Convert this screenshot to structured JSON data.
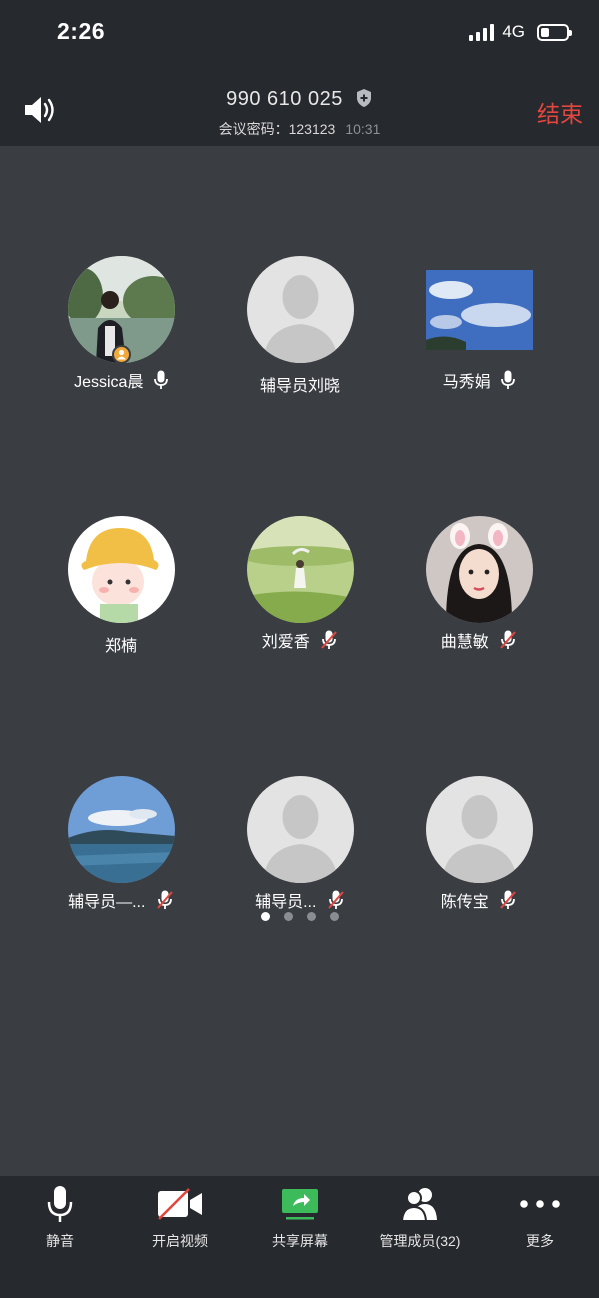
{
  "status_bar": {
    "time": "2:26",
    "network": "4G"
  },
  "header": {
    "meeting_id": "990 610 025",
    "password_label": "会议密码：123123",
    "duration": "10:31",
    "end_label": "结束"
  },
  "participants": [
    {
      "name": "Jessica晨",
      "mic": "on",
      "avatar": "photo-woman-river",
      "host": true
    },
    {
      "name": "辅导员刘晓",
      "mic": "none",
      "avatar": "default-silhouette"
    },
    {
      "name": "马秀娟",
      "mic": "on",
      "avatar": "photo-blue-sky"
    },
    {
      "name": "郑楠",
      "mic": "none",
      "avatar": "cartoon-girl-hat"
    },
    {
      "name": "刘爱香",
      "mic": "muted",
      "avatar": "photo-green-field"
    },
    {
      "name": "曲慧敏",
      "mic": "muted",
      "avatar": "photo-woman-bunny-ears"
    },
    {
      "name": "辅导员—...",
      "mic": "muted",
      "avatar": "photo-lake-mountains"
    },
    {
      "name": "辅导员...",
      "mic": "muted",
      "avatar": "default-silhouette"
    },
    {
      "name": "陈传宝",
      "mic": "muted",
      "avatar": "default-silhouette"
    }
  ],
  "pagination": {
    "pages": 4,
    "current": 1
  },
  "toolbar": {
    "mute_label": "静音",
    "video_label": "开启视频",
    "share_label": "共享屏幕",
    "members_label": "管理成员(32)",
    "more_label": "更多"
  },
  "colors": {
    "end_red": "#e2463f",
    "share_green": "#3dbb5b",
    "host_badge": "#f0a93a",
    "background": "#3a3e43",
    "bars": "#26292d"
  }
}
